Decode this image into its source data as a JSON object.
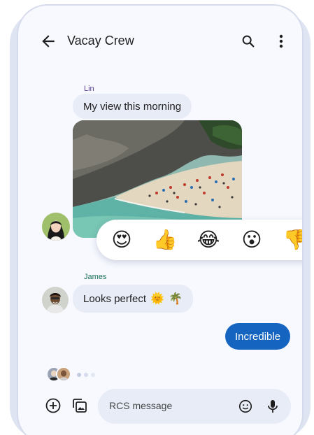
{
  "header": {
    "title": "Vacay Crew"
  },
  "messages": {
    "lin": {
      "sender": "Lin",
      "text": "My view this morning"
    },
    "james": {
      "sender": "James",
      "text": "Looks perfect",
      "emojis": [
        "🌞",
        "🌴"
      ]
    },
    "outgoing": {
      "text": "Incredible"
    }
  },
  "reactions": [
    "😍",
    "👍",
    "😂",
    "😮",
    "👎"
  ],
  "composer": {
    "placeholder": "RCS message"
  },
  "icons": [
    "back-arrow-icon",
    "search-icon",
    "more-vert-icon",
    "add-circle-icon",
    "gallery-icon",
    "emoji-icon",
    "mic-icon"
  ],
  "colors": {
    "accent": "#1565c0",
    "incoming_bubble": "#e8ecf7",
    "lin_name": "#5a3f91",
    "james_name": "#1b6e59"
  }
}
